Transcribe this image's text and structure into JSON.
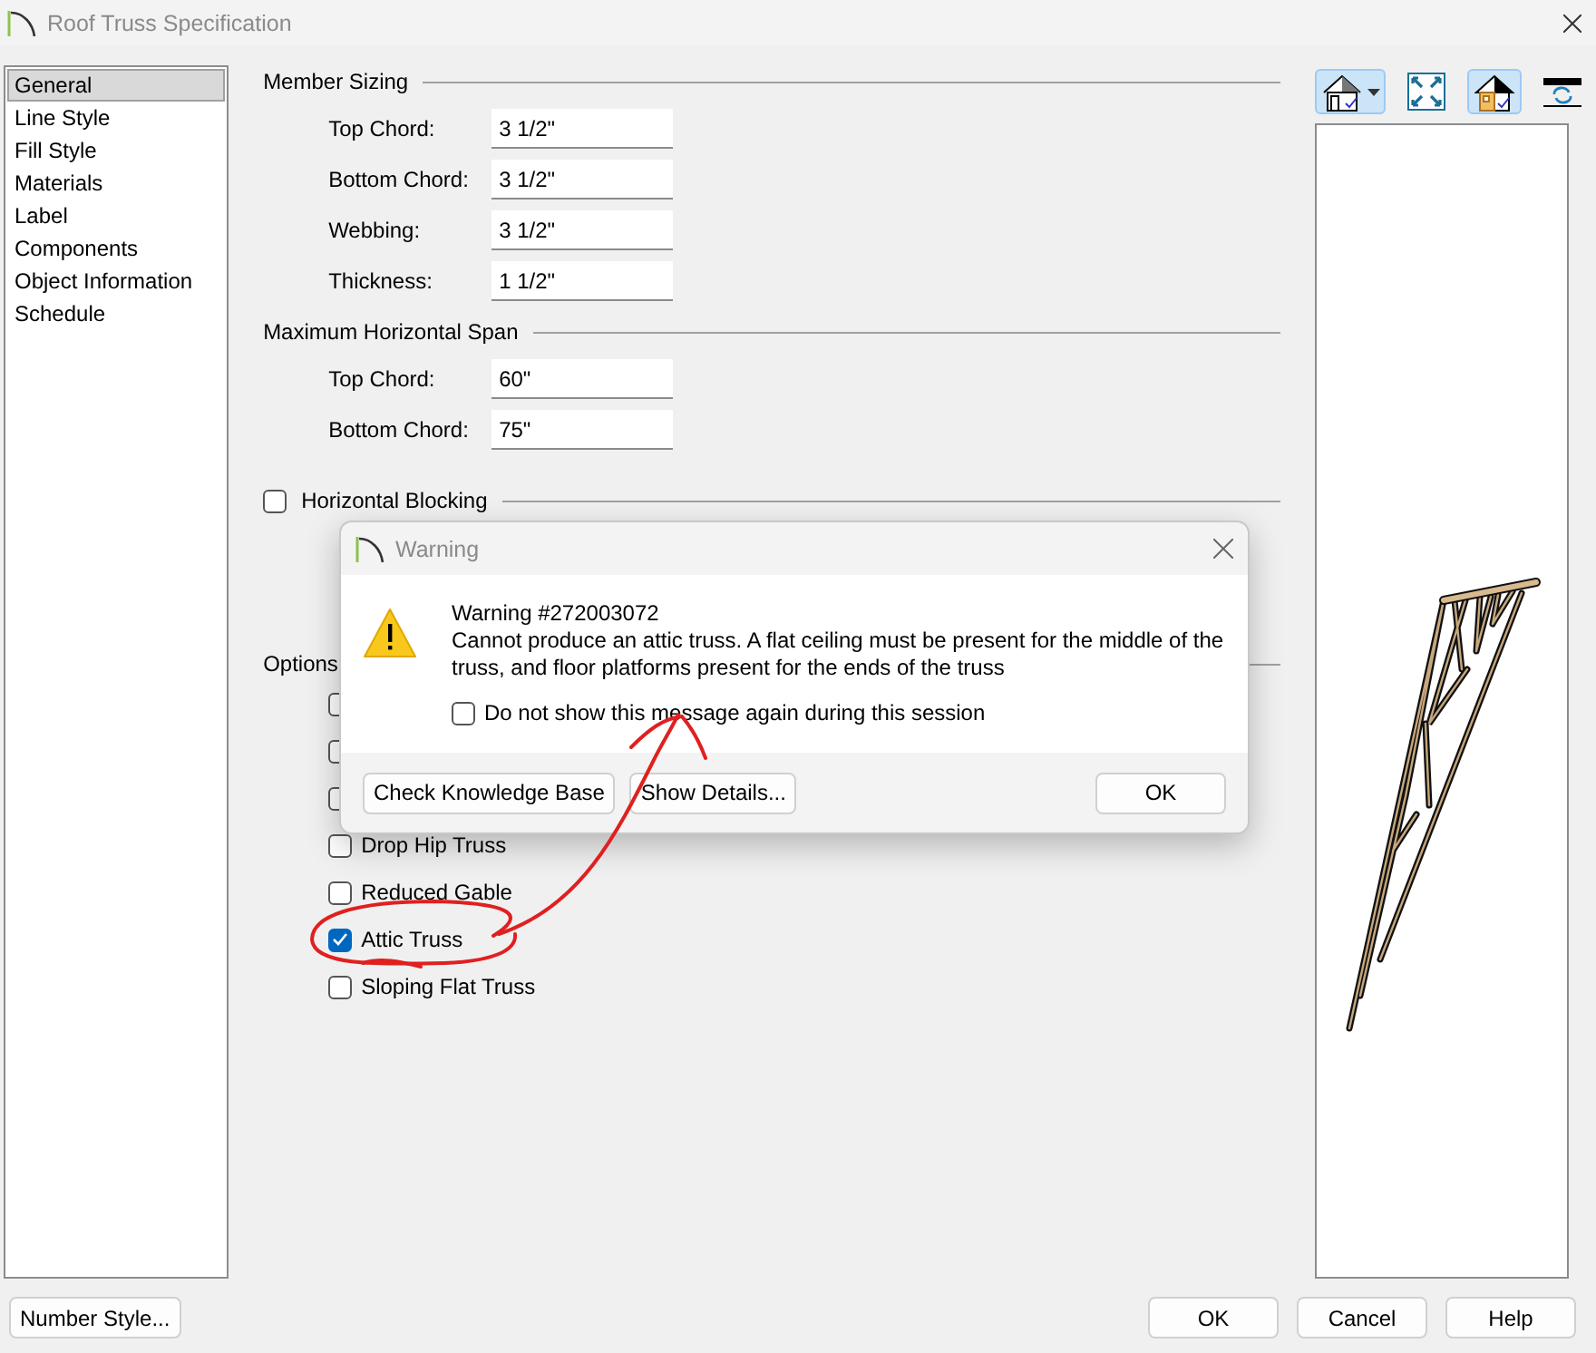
{
  "window": {
    "title": "Roof Truss Specification"
  },
  "sidebar": {
    "items": [
      {
        "label": "General",
        "selected": true
      },
      {
        "label": "Line Style",
        "selected": false
      },
      {
        "label": "Fill Style",
        "selected": false
      },
      {
        "label": "Materials",
        "selected": false
      },
      {
        "label": "Label",
        "selected": false
      },
      {
        "label": "Components",
        "selected": false
      },
      {
        "label": "Object Information",
        "selected": false
      },
      {
        "label": "Schedule",
        "selected": false
      }
    ]
  },
  "member_sizing": {
    "title": "Member Sizing",
    "fields": [
      {
        "label": "Top Chord:",
        "value": "3 1/2\""
      },
      {
        "label": "Bottom Chord:",
        "value": "3 1/2\""
      },
      {
        "label": "Webbing:",
        "value": "3 1/2\""
      },
      {
        "label": "Thickness:",
        "value": "1 1/2\""
      }
    ]
  },
  "max_span": {
    "title": "Maximum Horizontal Span",
    "fields": [
      {
        "label": "Top Chord:",
        "value": "60\""
      },
      {
        "label": "Bottom Chord:",
        "value": "75\""
      }
    ]
  },
  "horizontal_blocking": {
    "label": "Horizontal Blocking",
    "checked": false
  },
  "options": {
    "title": "Options",
    "items": [
      {
        "checked": false
      },
      {
        "checked": false
      },
      {
        "checked": false
      },
      {
        "label": "Drop Hip Truss",
        "checked": false
      },
      {
        "label": "Reduced Gable",
        "checked": false
      },
      {
        "label": "Attic Truss",
        "checked": true
      },
      {
        "label": "Sloping Flat Truss",
        "checked": false
      }
    ]
  },
  "toolbar": [
    {
      "kind": "house-view",
      "on": true
    },
    {
      "kind": "fit",
      "on": false
    },
    {
      "kind": "house-color",
      "on": true
    },
    {
      "kind": "refresh",
      "on": false
    }
  ],
  "footer": {
    "left_button": "Number Style...",
    "buttons": [
      "OK",
      "Cancel",
      "Help"
    ]
  },
  "warning": {
    "title": "Warning",
    "heading": "Warning #272003072",
    "message": "Cannot produce an attic truss. A flat ceiling must be present for the middle of the truss, and floor platforms present for the ends of the truss",
    "checkbox": {
      "label": "Do not show this message again during this session",
      "checked": false
    },
    "buttons": [
      "Check Knowledge Base",
      "Show Details..."
    ],
    "ok": "OK"
  }
}
